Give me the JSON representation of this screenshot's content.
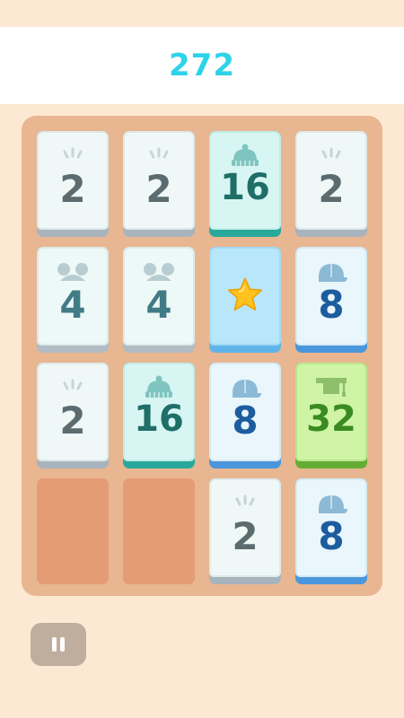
{
  "score": "272",
  "board": {
    "tiles": [
      {
        "row": 0,
        "col": 0,
        "value": "2",
        "icon": "sparkle-icon"
      },
      {
        "row": 0,
        "col": 1,
        "value": "2",
        "icon": "sparkle-icon"
      },
      {
        "row": 0,
        "col": 2,
        "value": "16",
        "icon": "beanie-hat-icon"
      },
      {
        "row": 0,
        "col": 3,
        "value": "2",
        "icon": "sparkle-icon"
      },
      {
        "row": 1,
        "col": 0,
        "value": "4",
        "icon": "mouse-ears-icon"
      },
      {
        "row": 1,
        "col": 1,
        "value": "4",
        "icon": "mouse-ears-icon"
      },
      {
        "row": 1,
        "col": 2,
        "value": "",
        "icon": "star-icon"
      },
      {
        "row": 1,
        "col": 3,
        "value": "8",
        "icon": "cap-icon"
      },
      {
        "row": 2,
        "col": 0,
        "value": "2",
        "icon": "sparkle-icon"
      },
      {
        "row": 2,
        "col": 1,
        "value": "16",
        "icon": "beanie-hat-icon"
      },
      {
        "row": 2,
        "col": 2,
        "value": "8",
        "icon": "cap-icon"
      },
      {
        "row": 2,
        "col": 3,
        "value": "32",
        "icon": "graduation-cap-icon"
      },
      {
        "row": 3,
        "col": 2,
        "value": "2",
        "icon": "sparkle-icon"
      },
      {
        "row": 3,
        "col": 3,
        "value": "8",
        "icon": "cap-icon"
      }
    ],
    "empty": [
      {
        "row": 3,
        "col": 0
      },
      {
        "row": 3,
        "col": 1
      }
    ]
  },
  "controls": {
    "pause_icon": "pause-icon"
  },
  "colors": {
    "background": "#fde8d3",
    "score": "#2ed3ea",
    "board": "#e8b690",
    "empty_slot": "#e49c74"
  }
}
